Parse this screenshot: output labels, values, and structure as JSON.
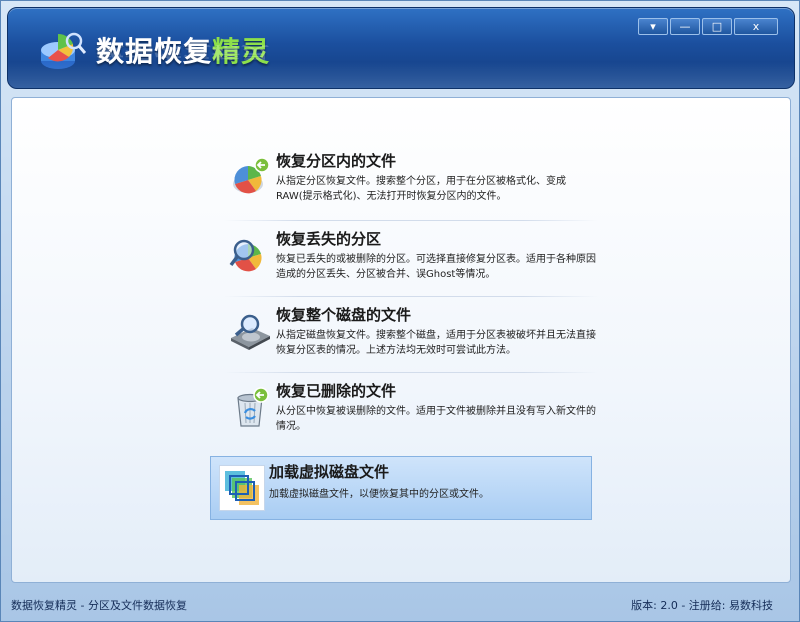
{
  "window": {
    "title_part1": "数据恢复",
    "title_part2": "精灵",
    "controls": {
      "menu": "▾",
      "minimize": "—",
      "maximize": "□",
      "close": "x"
    }
  },
  "options": [
    {
      "title": "恢复分区内的文件",
      "desc": "从指定分区恢复文件。搜索整个分区，用于在分区被格式化、变成RAW(提示格式化)、无法打开时恢复分区内的文件。",
      "icon": "partition-pie-icon"
    },
    {
      "title": "恢复丢失的分区",
      "desc": "恢复已丢失的或被删除的分区。可选择直接修复分区表。适用于各种原因造成的分区丢失、分区被合并、误Ghost等情况。",
      "icon": "partition-search-icon"
    },
    {
      "title": "恢复整个磁盘的文件",
      "desc": "从指定磁盘恢复文件。搜索整个磁盘，适用于分区表被破坏并且无法直接恢复分区表的情况。上述方法均无效时可尝试此方法。",
      "icon": "disk-search-icon"
    },
    {
      "title": "恢复已删除的文件",
      "desc": "从分区中恢复被误删除的文件。适用于文件被删除并且没有写入新文件的情况。",
      "icon": "recycle-bin-icon"
    },
    {
      "title": "加载虚拟磁盘文件",
      "desc": "加载虚拟磁盘文件，以便恢复其中的分区或文件。",
      "icon": "virtual-disk-icon",
      "selected": true
    }
  ],
  "status": {
    "left": "数据恢复精灵 - 分区及文件数据恢复",
    "right": "版本: 2.0 - 注册给: 易数科技"
  },
  "colors": {
    "header": "#1b4f9e",
    "accent_title": "#8de04a",
    "selected_bg": "#b7d6f6"
  }
}
